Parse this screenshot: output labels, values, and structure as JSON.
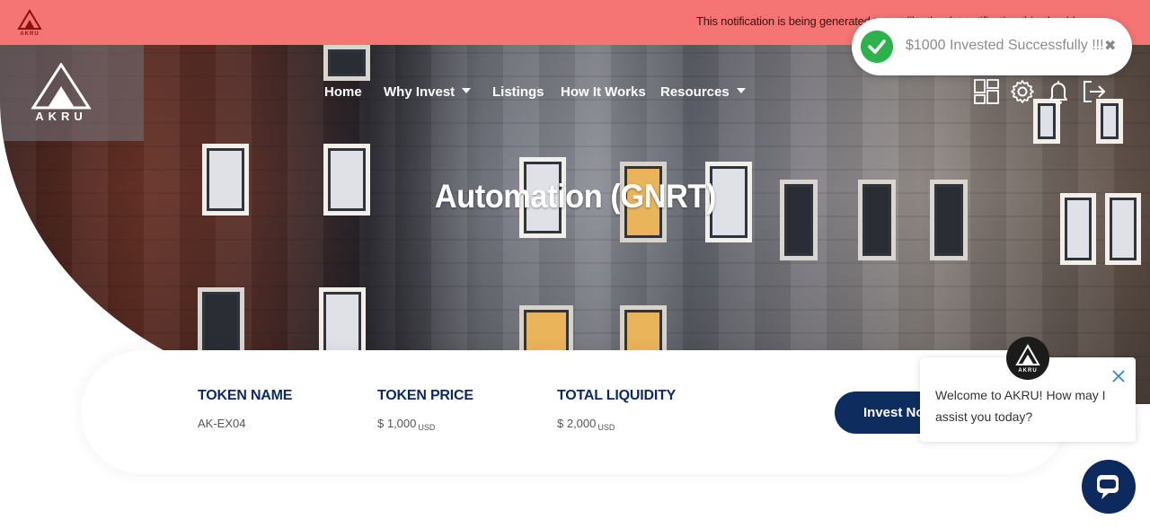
{
  "notification_bar": {
    "logo_icon": "akru-logo-icon",
    "text": "This notification is being generated to test like the dot notification this should scope",
    "bg_color": "#f47574"
  },
  "header": {
    "logo_brand": "AKRU",
    "nav": [
      {
        "label": "Home",
        "has_dropdown": false
      },
      {
        "label": "Why Invest",
        "has_dropdown": true
      },
      {
        "label": "Listings",
        "has_dropdown": false
      },
      {
        "label": "How It Works",
        "has_dropdown": false
      },
      {
        "label": "Resources",
        "has_dropdown": true
      }
    ],
    "icons": [
      "dashboard-icon",
      "settings-icon",
      "bell-icon",
      "logout-icon"
    ]
  },
  "hero": {
    "title": "Automation (GNRT)"
  },
  "toast": {
    "icon": "check-circle-icon",
    "message": "$1000 Invested Successfully !!!",
    "close": "✖",
    "accent": "#2db24b"
  },
  "token_card": {
    "token_name_label": "TOKEN NAME",
    "token_name_value": "AK-EX04",
    "token_price_label": "TOKEN PRICE",
    "token_price_value": "$ 1,000",
    "token_price_unit": "USD",
    "total_liquidity_label": "TOTAL LIQUIDITY",
    "total_liquidity_value": "$ 2,000",
    "total_liquidity_unit": "USD",
    "invest_button": "Invest Now",
    "brand_color": "#0e2c5e"
  },
  "chat": {
    "avatar_icon": "akru-logo-icon",
    "message": "Welcome to AKRU! How may I assist you today?",
    "close_icon": "close-icon",
    "launcher_icon": "chat-bubble-icon"
  }
}
